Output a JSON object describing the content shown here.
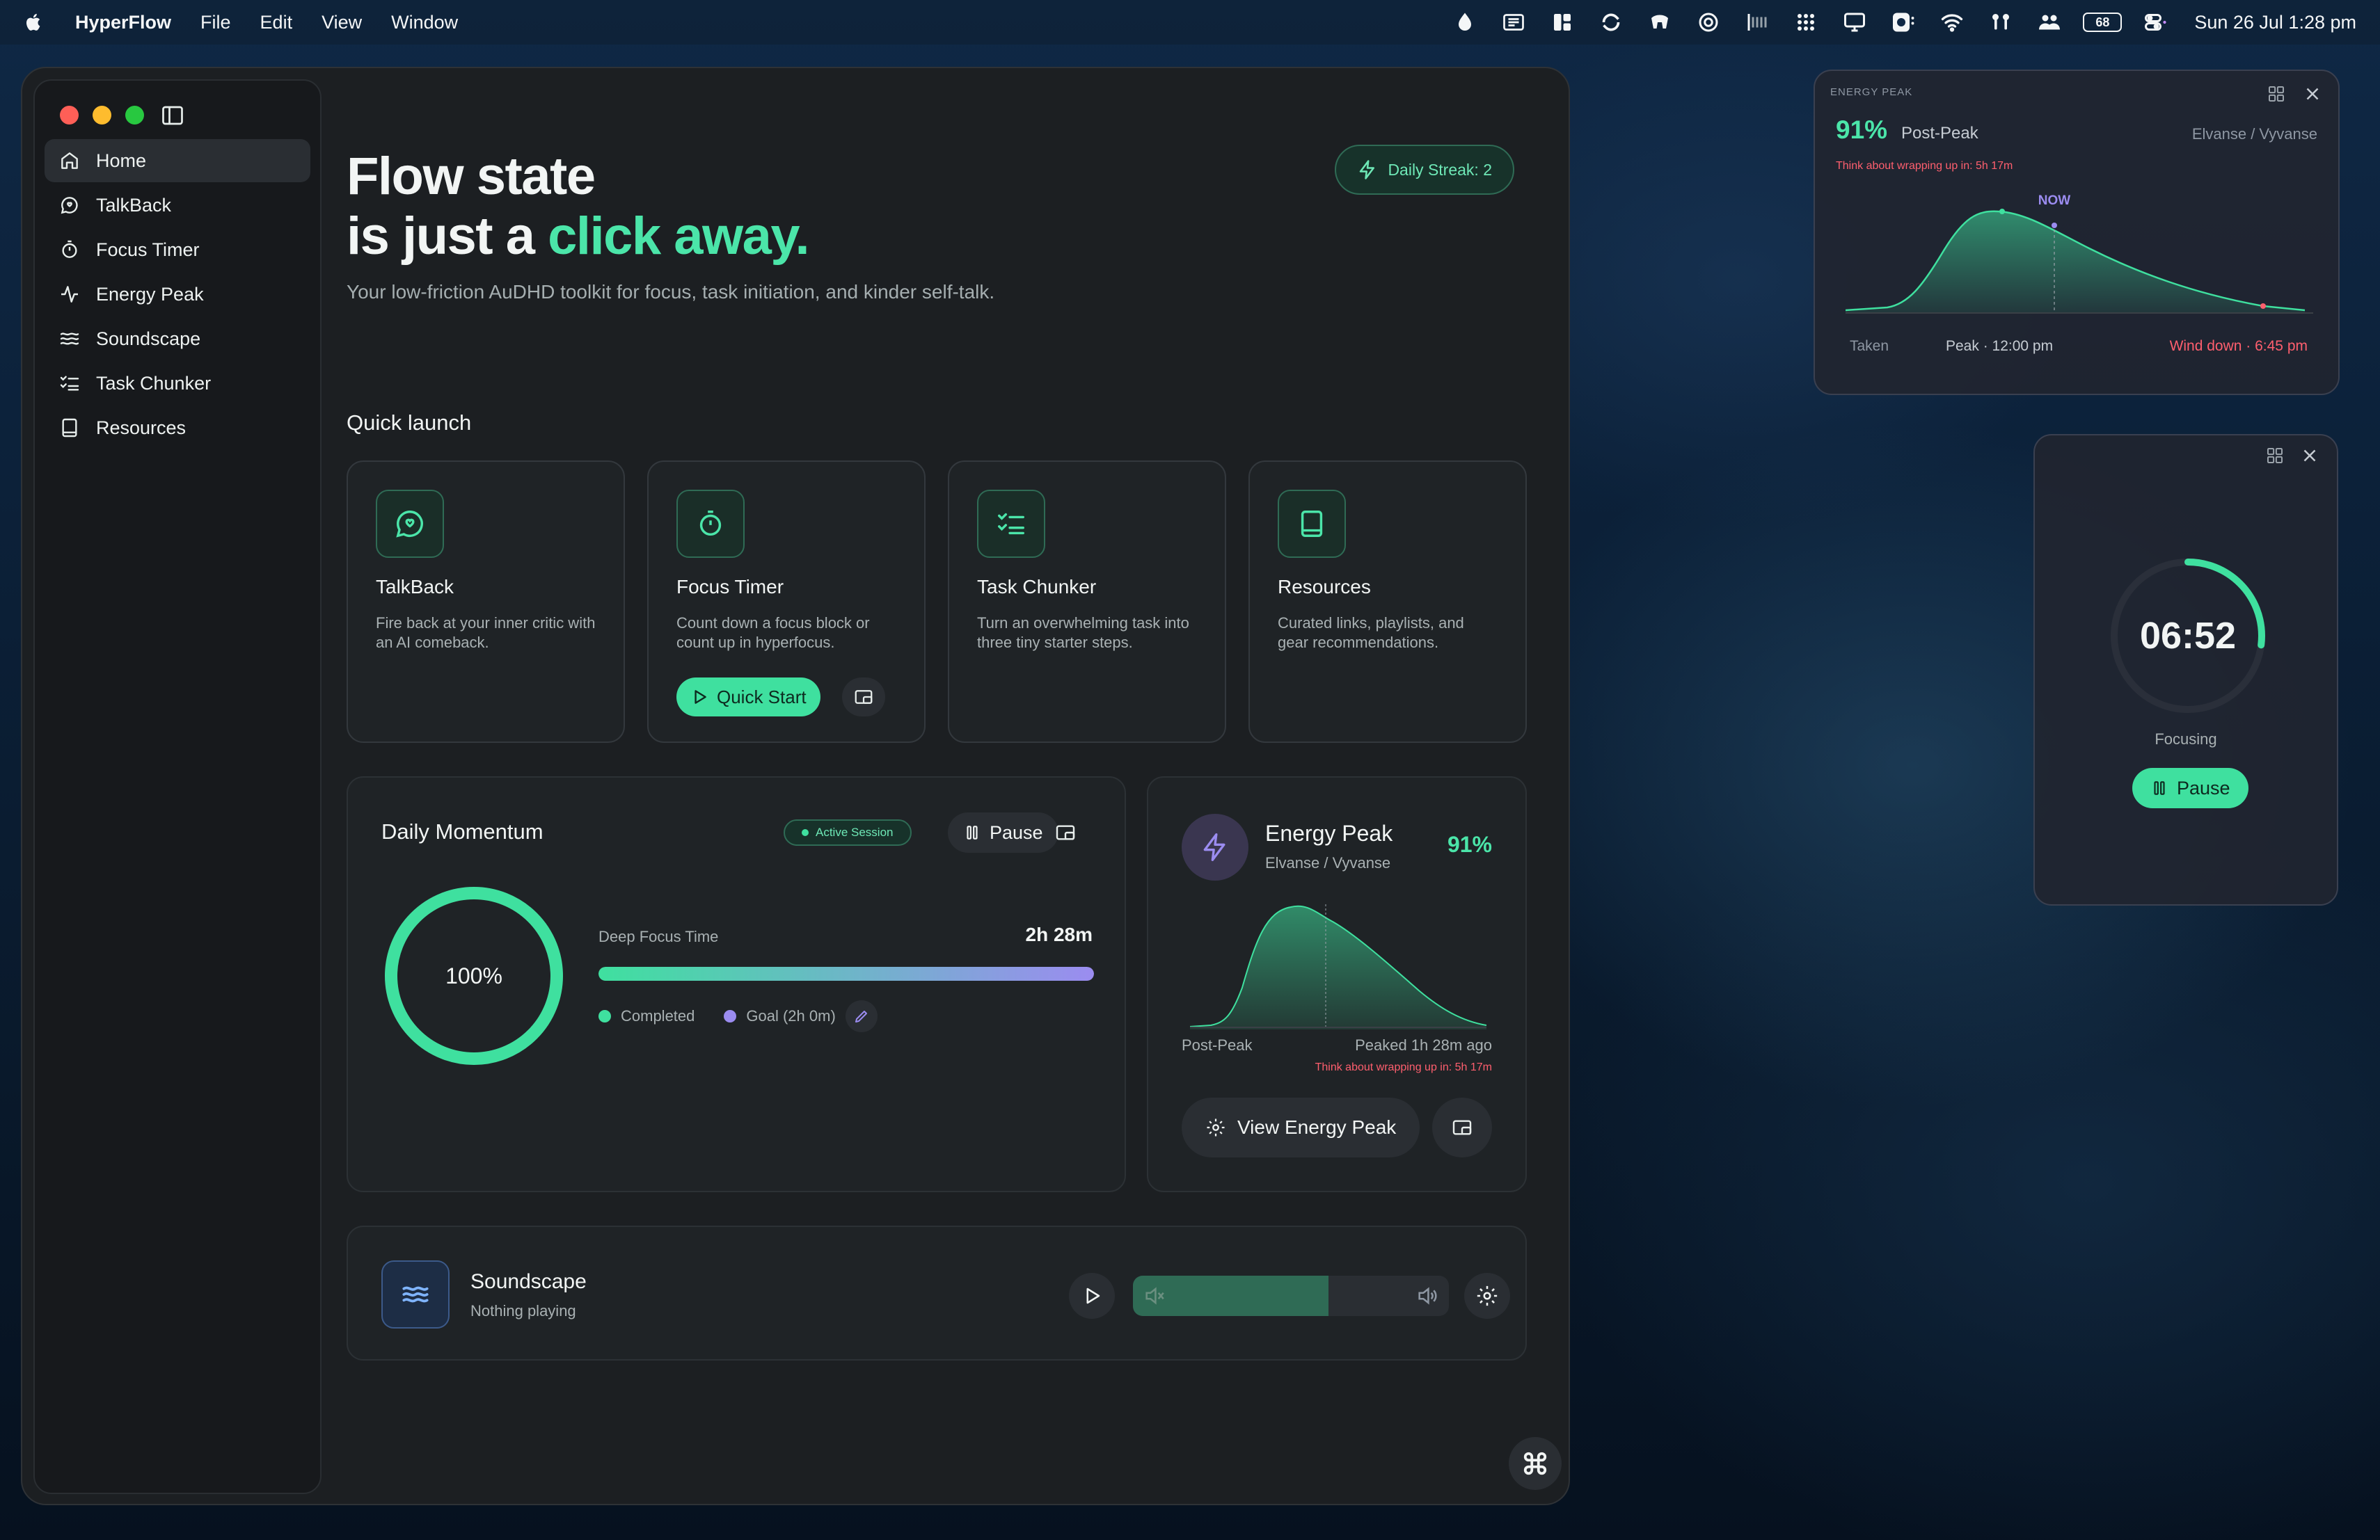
{
  "menubar": {
    "app_name": "HyperFlow",
    "menus": [
      "File",
      "Edit",
      "View",
      "Window"
    ],
    "battery": "68",
    "clock": "Sun 26 Jul  1:28 pm",
    "status_icons": [
      "drop-icon",
      "reader-icon",
      "layout-icon",
      "sync-icon",
      "bars-icon",
      "target-icon",
      "equalizer-icon",
      "grid-icon",
      "display-icon",
      "record-icon",
      "wifi-icon",
      "airpods-icon",
      "users-icon",
      "control-center-icon"
    ]
  },
  "sidebar": {
    "items": [
      {
        "label": "Home",
        "icon": "house-icon",
        "active": true
      },
      {
        "label": "TalkBack",
        "icon": "chat-icon"
      },
      {
        "label": "Focus Timer",
        "icon": "stopwatch-icon"
      },
      {
        "label": "Energy Peak",
        "icon": "pulse-icon"
      },
      {
        "label": "Soundscape",
        "icon": "waves-icon"
      },
      {
        "label": "Task Chunker",
        "icon": "checklist-icon"
      },
      {
        "label": "Resources",
        "icon": "book-icon"
      }
    ]
  },
  "hero": {
    "line1": "Flow state",
    "line2_prefix": "is just a ",
    "line2_accent": "click away.",
    "tagline": "Your low-friction AuDHD toolkit for focus, task initiation, and kinder self-talk."
  },
  "streak": {
    "label": "Daily Streak: 2"
  },
  "quick_launch": {
    "title": "Quick launch",
    "cards": [
      {
        "title": "TalkBack",
        "desc": "Fire back at your inner critic with an AI comeback.",
        "icon": "heart-chat-icon"
      },
      {
        "title": "Focus Timer",
        "desc": "Count down a focus block or count up in hyperfocus.",
        "icon": "stopwatch-icon",
        "button": "Quick Start"
      },
      {
        "title": "Task Chunker",
        "desc": "Turn an overwhelming task into three tiny starter steps.",
        "icon": "checklist-icon"
      },
      {
        "title": "Resources",
        "desc": "Curated links, playlists, and gear recommendations.",
        "icon": "book-icon"
      }
    ]
  },
  "momentum": {
    "title": "Daily Momentum",
    "badge": "Active Session",
    "pause_label": "Pause",
    "ring_label": "100%",
    "ring_fraction": 1.0,
    "deep_focus_label": "Deep Focus Time",
    "deep_focus_value": "2h 28m",
    "progress_fraction": 1.0,
    "legend_completed": "Completed",
    "legend_goal": "Goal (2h 0m)",
    "colors": {
      "completed": "#3fe09f",
      "goal": "#9b8cf0"
    }
  },
  "energy_card": {
    "title": "Energy Peak",
    "subtitle": "Elvanse / Vyvanse",
    "percent": "91%",
    "status": "Post-Peak",
    "peaked": "Peaked 1h 28m ago",
    "warning": "Think about wrapping up in: 5h 17m",
    "view_button": "View Energy Peak"
  },
  "soundscape": {
    "title": "Soundscape",
    "subtitle": "Nothing playing",
    "volume_fraction": 0.62
  },
  "energy_widget": {
    "label": "ENERGY PEAK",
    "percent": "91%",
    "status": "Post-Peak",
    "medication": "Elvanse / Vyvanse",
    "warning": "Think about wrapping up in: 5h 17m",
    "now_label": "NOW",
    "taken_label": "Taken",
    "peak_label": "Peak · 12:00 pm",
    "wind_label": "Wind down · 6:45 pm"
  },
  "timer_widget": {
    "time": "06:52",
    "status": "Focusing",
    "pause_label": "Pause",
    "progress_fraction": 0.27
  },
  "colors": {
    "accent": "#3fe09f",
    "accent_text": "#4be5a9",
    "warning": "#ff5f6e",
    "purple": "#9b8cf0"
  }
}
